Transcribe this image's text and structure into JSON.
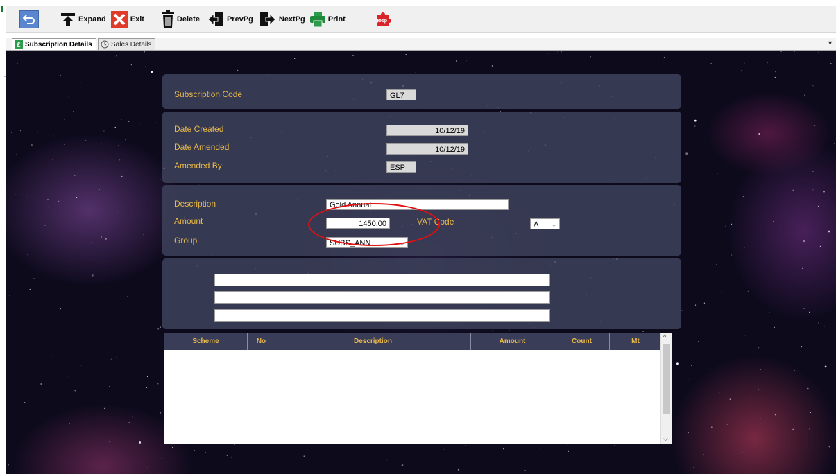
{
  "toolbar": {
    "expand_label": "Expand",
    "exit_label": "Exit",
    "delete_label": "Delete",
    "prevpg_label": "PrevPg",
    "nextpg_label": "NextPg",
    "print_label": "Print",
    "logo_text": "esp"
  },
  "tabs": [
    {
      "label": "Subscription Details",
      "active": true
    },
    {
      "label": "Sales Details",
      "active": false
    }
  ],
  "form": {
    "subscription_code_label": "Subscription Code",
    "subscription_code_value": "GL7",
    "date_created_label": "Date Created",
    "date_created_value": "10/12/19",
    "date_amended_label": "Date Amended",
    "date_amended_value": "10/12/19",
    "amended_by_label": "Amended By",
    "amended_by_value": "ESP",
    "description_label": "Description",
    "description_value": "Gold Annual",
    "amount_label": "Amount",
    "amount_value": "1450.00",
    "vat_code_label": "VAT Code",
    "vat_code_value": "A",
    "group_label": "Group",
    "group_value": "SUBS_ANN",
    "notes": [
      "",
      "",
      ""
    ]
  },
  "grid": {
    "columns": [
      "Scheme",
      "No",
      "Description",
      "Amount",
      "Count",
      "Mt"
    ],
    "rows": []
  },
  "colors": {
    "label_gold": "#e8b94a",
    "panel": "#3e425c",
    "annotation": "#e01010"
  }
}
